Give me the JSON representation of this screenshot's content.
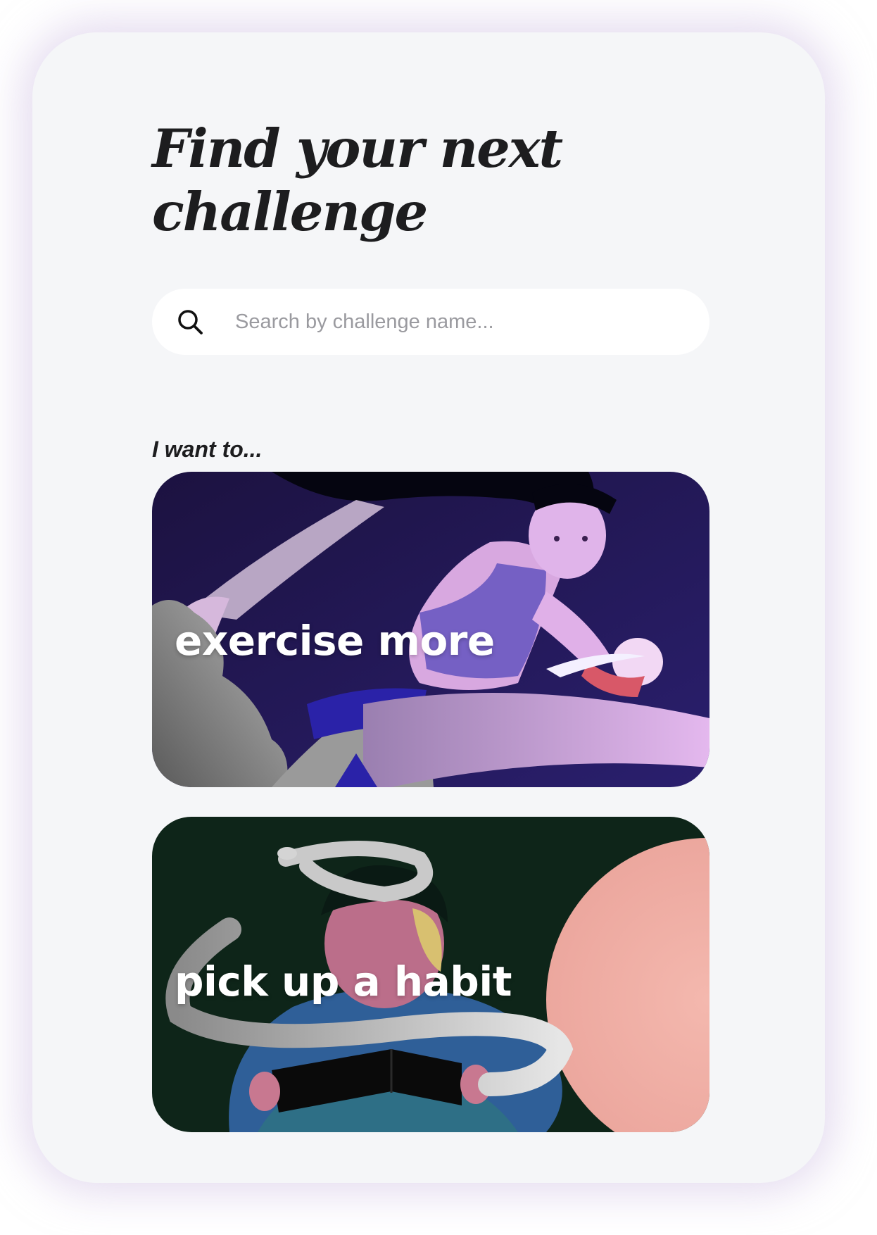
{
  "header": {
    "title_line1": "Find your next",
    "title_line2": "challenge"
  },
  "search": {
    "placeholder": "Search by challenge name...",
    "value": "",
    "icon": "search-icon"
  },
  "section": {
    "label": "I want to..."
  },
  "cards": [
    {
      "label": "exercise more",
      "illustration": "running-figure-illustration"
    },
    {
      "label": "pick up a habit",
      "illustration": "reading-figure-illustration"
    }
  ]
}
